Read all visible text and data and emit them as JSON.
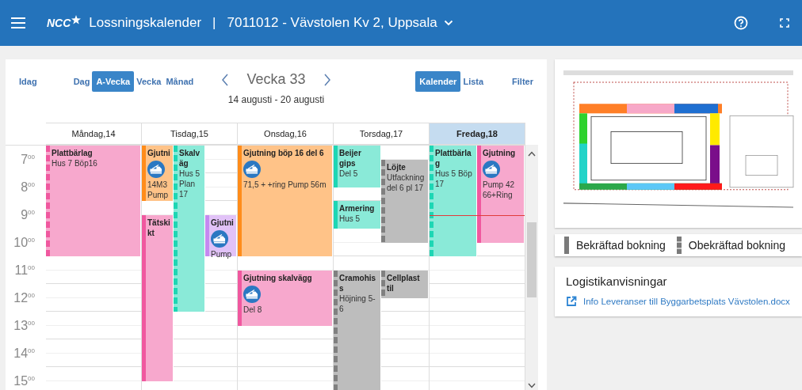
{
  "header": {
    "brand": "NCC",
    "app_title": "Lossningskalender",
    "separator": "|",
    "project": "7011012 - Vävstolen Kv 2, Uppsala"
  },
  "toolbar": {
    "today": "Idag",
    "views": [
      {
        "label": "Dag",
        "selected": false
      },
      {
        "label": "A-Vecka",
        "selected": true
      },
      {
        "label": "Vecka",
        "selected": false
      },
      {
        "label": "Månad",
        "selected": false
      }
    ],
    "week_title": "Vecka 33",
    "date_range": "14 augusti - 20 augusti",
    "modes": [
      {
        "label": "Kalender",
        "selected": true
      },
      {
        "label": "Lista",
        "selected": false
      }
    ],
    "filter": "Filter"
  },
  "calendar": {
    "hours": [
      "7$^{00}$",
      "8$^{00}$",
      "9$^{00}$",
      "10$^{00}$",
      "11$^{00}$",
      "12$^{00}$",
      "13$^{00}$",
      "14$^{00}$",
      "15$^{00}$"
    ],
    "days": [
      {
        "label": "Måndag,14",
        "selected": false,
        "events": [
          {
            "title": "Plattbärlag",
            "details": [
              "Hus 7 Böp16"
            ],
            "color": "#f0589f",
            "confirmed": false,
            "pump_icon": false
          }
        ]
      },
      {
        "label": "Tisdag,15",
        "selected": false,
        "events": [
          {
            "title": "Gjutni",
            "details": [
              "14M3",
              "Pump"
            ],
            "color": "#ff8c1a",
            "confirmed": true,
            "pump_icon": true
          },
          {
            "title": "Skalväg",
            "details": [
              "Hus 5",
              "Plan",
              "17"
            ],
            "color": "#1ed6b4",
            "confirmed": false,
            "pump_icon": false
          },
          {
            "title": "Tätskikt",
            "color": "#f0589f",
            "confirmed": true,
            "pump_icon": false
          },
          {
            "title": "Gjutni",
            "details": [
              "Pump"
            ],
            "color": "#c58af0",
            "confirmed": true,
            "pump_icon": true
          }
        ]
      },
      {
        "label": "Onsdag,16",
        "selected": false,
        "events": [
          {
            "title": "Gjutning böp 16 del 6",
            "details": [
              "71,5 + +ring Pump 56m"
            ],
            "color": "#ff8c1a",
            "confirmed": true,
            "pump_icon": true
          },
          {
            "title": "Gjutning skalvägg",
            "details": [
              "Del 8"
            ],
            "color": "#f0589f",
            "confirmed": true,
            "pump_icon": true
          }
        ]
      },
      {
        "label": "Torsdag,17",
        "selected": false,
        "events": [
          {
            "title": "Beijer gips",
            "details": [
              "Del 5"
            ],
            "color": "#1ed6b4",
            "confirmed": true,
            "pump_icon": false
          },
          {
            "title": "Löjte",
            "details": [
              "Utfackning del 6 pl 17"
            ],
            "color": "#808080",
            "confirmed": false,
            "pump_icon": false
          },
          {
            "title": "Armering",
            "details": [
              "Hus 5"
            ],
            "color": "#1ed6b4",
            "confirmed": true,
            "pump_icon": false
          },
          {
            "title": "Cramohiss",
            "details": [
              "Höjning 5-6"
            ],
            "color": "#808080",
            "confirmed": false,
            "pump_icon": false
          },
          {
            "title": "Cellplast til",
            "color": "#808080",
            "confirmed": false,
            "pump_icon": false
          }
        ]
      },
      {
        "label": "Fredag,18",
        "selected": true,
        "events": [
          {
            "title": "Plattbärlag",
            "details": [
              "Hus 5 Böp 17"
            ],
            "color": "#1ed6b4",
            "confirmed": false,
            "pump_icon": false
          },
          {
            "title": "Gjutning",
            "details": [
              "Pump 42 66+Ring"
            ],
            "color": "#f0589f",
            "confirmed": true,
            "pump_icon": true
          }
        ]
      }
    ]
  },
  "legend": [
    {
      "label": "Bekräftad bokning",
      "confirmed": true
    },
    {
      "label": "Obekräftad bokning",
      "confirmed": false
    }
  ],
  "logistics": {
    "title": "Logistikanvisningar",
    "links": [
      "Info Leveranser till Byggarbetsplats Vävstolen.docx"
    ]
  }
}
